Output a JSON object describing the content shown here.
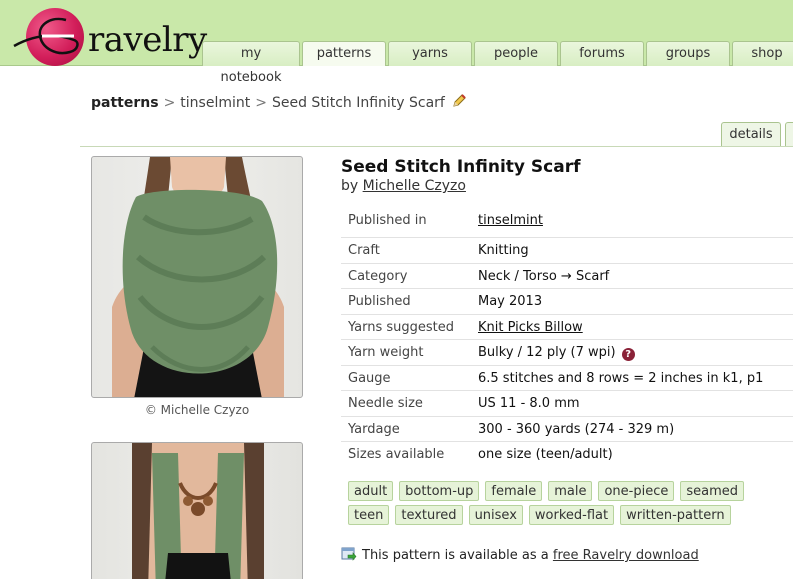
{
  "site": {
    "logo_text": "ravelry",
    "colors": {
      "header": "#c9e8a9",
      "logo_circle": "#d21e5a",
      "tag_bg": "#e6f3d8"
    }
  },
  "nav": {
    "tabs": [
      "my notebook",
      "patterns",
      "yarns",
      "people",
      "forums",
      "groups",
      "shop"
    ],
    "active": "patterns"
  },
  "breadcrumb": {
    "section": "patterns",
    "designer": "tinselmint",
    "current": "Seed Stitch Infinity Scarf",
    "edit_icon": "pencil-icon"
  },
  "side_tabs": {
    "details": "details"
  },
  "pattern": {
    "title": "Seed Stitch Infinity Scarf",
    "by_prefix": "by",
    "author": "Michelle Czyzo",
    "photo_caption": "© Michelle Czyzo",
    "details": [
      {
        "label": "Published in",
        "value": "tinselmint"
      },
      {
        "label": "Craft",
        "value": "Knitting"
      },
      {
        "label": "Category",
        "value": "Neck / Torso → Scarf"
      },
      {
        "label": "Published",
        "value": "May 2013"
      },
      {
        "label": "Yarns suggested",
        "value": "Knit Picks Billow"
      },
      {
        "label": "Yarn weight",
        "value": "Bulky / 12 ply (7 wpi)"
      },
      {
        "label": "Gauge",
        "value": "6.5 stitches and 8 rows = 2 inches in k1, p1"
      },
      {
        "label": "Needle size",
        "value": "US 11 - 8.0 mm"
      },
      {
        "label": "Yardage",
        "value": "300 - 360 yards (274 - 329 m)"
      },
      {
        "label": "Sizes available",
        "value": "one size (teen/adult)"
      }
    ],
    "help_icon_text": "?",
    "tags": [
      "adult",
      "bottom-up",
      "female",
      "male",
      "one-piece",
      "seamed",
      "teen",
      "textured",
      "unisex",
      "worked-flat",
      "written-pattern"
    ],
    "download": {
      "prefix": "This pattern is available as a",
      "link": "free Ravelry download"
    }
  }
}
